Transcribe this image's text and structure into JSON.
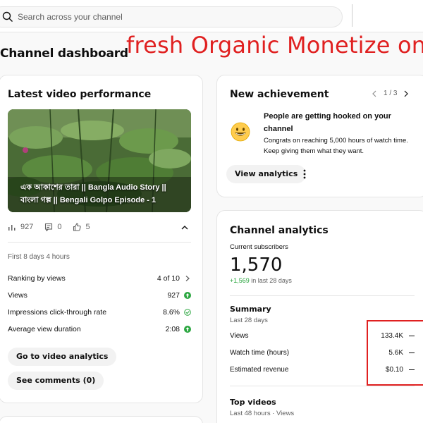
{
  "search": {
    "placeholder": "Search across your channel"
  },
  "page": {
    "title": "Channel dashboard",
    "overlay_text": "fresh Organic Monetize on"
  },
  "latest_video": {
    "heading": "Latest video performance",
    "thumbnail_title": "এক আকাশের তারা || Bangla Audio Story || বাংলা গল্প || Bengali Golpo Episode - 1",
    "stats": {
      "views": "927",
      "comments": "0",
      "likes": "5"
    },
    "period": "First 8 days 4 hours",
    "metrics": [
      {
        "label": "Ranking by views",
        "value": "4 of 10",
        "icon": "chevron-right-icon"
      },
      {
        "label": "Views",
        "value": "927",
        "icon": "arrow-up-green-icon"
      },
      {
        "label": "Impressions click-through rate",
        "value": "8.6%",
        "icon": "check-circle-icon"
      },
      {
        "label": "Average view duration",
        "value": "2:08",
        "icon": "arrow-up-green-icon"
      }
    ],
    "buttons": {
      "analytics": "Go to video analytics",
      "comments": "See comments (0)"
    }
  },
  "achievement": {
    "heading": "New achievement",
    "pager": "1 / 3",
    "emoji": "grinning-face",
    "headline": "People are getting hooked on your channel",
    "body": "Congrats on reaching 5,000 hours of watch time. Keep giving them what they want.",
    "button": "View analytics"
  },
  "analytics": {
    "heading": "Channel analytics",
    "subs_label": "Current subscribers",
    "subs_count": "1,570",
    "subs_delta": "+1,569",
    "subs_delta_suffix": "in last 28 days",
    "summary_heading": "Summary",
    "summary_period": "Last 28 days",
    "summary": [
      {
        "label": "Views",
        "value": "133.4K"
      },
      {
        "label": "Watch time (hours)",
        "value": "5.6K"
      },
      {
        "label": "Estimated revenue",
        "value": "$0.10"
      }
    ],
    "top_videos_heading": "Top videos",
    "top_videos_period": "Last 48 hours · Views"
  },
  "colors": {
    "accent_red": "#e02020",
    "up_green": "#2ba640",
    "check_green": "#2ba640"
  }
}
